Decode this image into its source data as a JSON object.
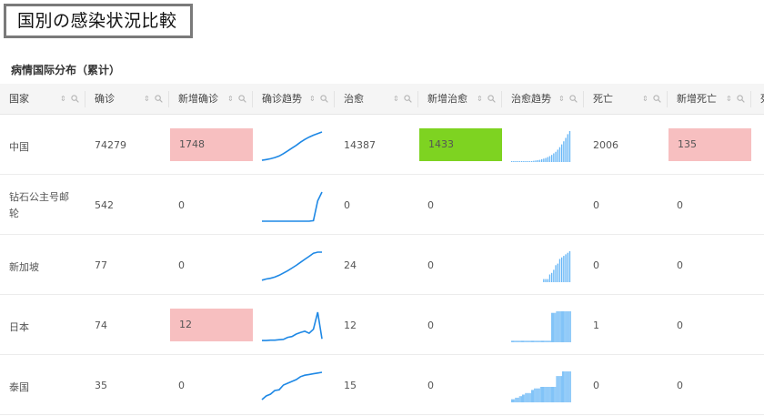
{
  "caption": "国別の感染状況比較",
  "section_title": "病情国际分布（累计）",
  "columns": [
    "国家",
    "确诊",
    "新增确诊",
    "确诊趋势",
    "治愈",
    "新增治愈",
    "治愈趋势",
    "死亡",
    "新增死亡",
    "死"
  ],
  "colors": {
    "new_confirmed_bg": "#f7bfc0",
    "new_cured_bg": "#7ed321",
    "sparkline": "#1e88e5",
    "bars": "#64b5f6"
  },
  "rows": [
    {
      "country": "中国",
      "confirmed": "74279",
      "new_confirmed": "1748",
      "cured": "14387",
      "new_cured": "1433",
      "deaths": "2006",
      "new_deaths": "135",
      "confirmed_trend": [
        2,
        4,
        6,
        9,
        13,
        19,
        26,
        33,
        40,
        48,
        55,
        61,
        66,
        70,
        74
      ],
      "cured_trend": [
        0,
        0,
        0,
        0,
        1,
        1,
        1,
        2,
        2,
        3,
        3,
        4,
        5,
        6,
        7,
        9,
        11,
        13,
        16,
        19,
        23,
        28,
        33,
        40,
        48,
        57,
        67,
        78,
        90,
        100
      ]
    },
    {
      "country": "钻石公主号邮轮",
      "confirmed": "542",
      "new_confirmed": "0",
      "cured": "0",
      "new_cured": "0",
      "deaths": "0",
      "new_deaths": "0",
      "confirmed_trend": [
        0,
        0,
        0,
        0,
        0,
        0,
        0,
        0,
        0,
        0,
        0,
        0,
        2,
        70,
        100
      ],
      "cured_trend": []
    },
    {
      "country": "新加坡",
      "confirmed": "77",
      "new_confirmed": "0",
      "cured": "24",
      "new_cured": "0",
      "deaths": "0",
      "new_deaths": "0",
      "confirmed_trend": [
        3,
        6,
        8,
        11,
        16,
        22,
        28,
        35,
        42,
        50,
        58,
        66,
        74,
        77,
        77
      ],
      "cured_trend": [
        10,
        10,
        10,
        25,
        30,
        40,
        55,
        60,
        75,
        80,
        85,
        90,
        95,
        100
      ]
    },
    {
      "country": "日本",
      "confirmed": "74",
      "new_confirmed": "12",
      "cured": "12",
      "new_cured": "0",
      "deaths": "1",
      "new_deaths": "0",
      "confirmed_trend": [
        2,
        2,
        3,
        3,
        4,
        5,
        10,
        12,
        18,
        22,
        25,
        20,
        30,
        72,
        6
      ],
      "cured_trend": [
        5,
        5,
        5,
        5,
        5,
        5,
        5,
        5,
        5,
        5,
        5,
        5,
        5,
        5,
        5,
        5,
        5,
        5,
        5,
        5,
        5,
        5,
        5,
        5,
        5,
        5,
        5,
        5,
        5,
        5,
        5,
        5,
        5,
        5,
        5,
        5,
        5,
        5,
        5,
        5,
        95,
        95,
        95,
        95,
        95,
        100,
        100,
        100,
        100,
        100,
        100,
        100,
        100,
        100,
        100,
        100,
        100,
        100,
        100,
        100
      ]
    },
    {
      "country": "泰国",
      "confirmed": "35",
      "new_confirmed": "0",
      "cured": "15",
      "new_cured": "0",
      "deaths": "0",
      "new_deaths": "0",
      "confirmed_trend": [
        5,
        15,
        20,
        30,
        32,
        45,
        50,
        55,
        60,
        68,
        72,
        74,
        76,
        78,
        80
      ],
      "cured_trend": [
        10,
        10,
        10,
        10,
        15,
        15,
        15,
        15,
        20,
        20,
        20,
        25,
        25,
        25,
        30,
        30,
        30,
        30,
        30,
        30,
        40,
        40,
        40,
        45,
        45,
        45,
        45,
        45,
        45,
        50,
        50,
        50,
        50,
        50,
        50,
        50,
        50,
        50,
        50,
        50,
        50,
        50,
        50,
        50,
        50,
        85,
        85,
        85,
        85,
        85,
        85,
        100,
        100,
        100,
        100,
        100,
        100,
        100,
        100,
        100
      ]
    }
  ]
}
